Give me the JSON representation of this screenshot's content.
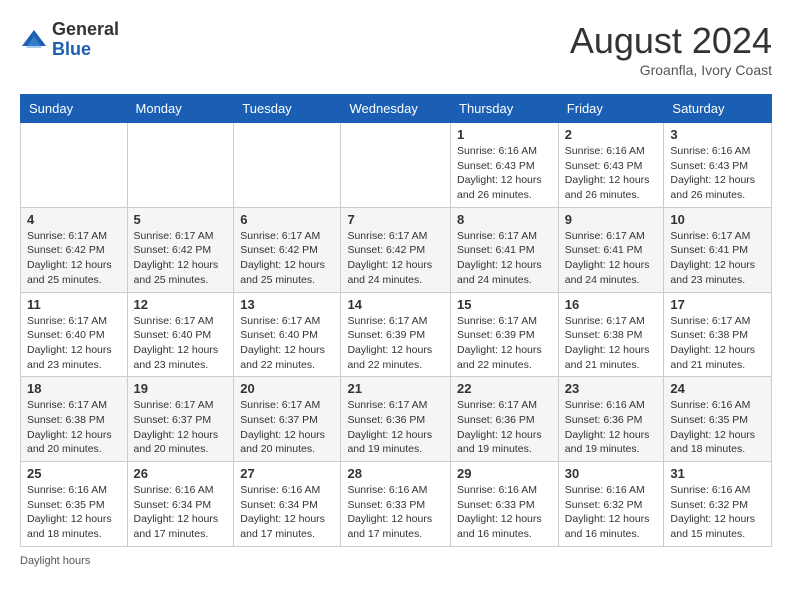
{
  "header": {
    "logo_general": "General",
    "logo_blue": "Blue",
    "month_year": "August 2024",
    "location": "Groanfla, Ivory Coast"
  },
  "days_of_week": [
    "Sunday",
    "Monday",
    "Tuesday",
    "Wednesday",
    "Thursday",
    "Friday",
    "Saturday"
  ],
  "weeks": [
    [
      {
        "day": "",
        "info": ""
      },
      {
        "day": "",
        "info": ""
      },
      {
        "day": "",
        "info": ""
      },
      {
        "day": "",
        "info": ""
      },
      {
        "day": "1",
        "info": "Sunrise: 6:16 AM\nSunset: 6:43 PM\nDaylight: 12 hours\nand 26 minutes."
      },
      {
        "day": "2",
        "info": "Sunrise: 6:16 AM\nSunset: 6:43 PM\nDaylight: 12 hours\nand 26 minutes."
      },
      {
        "day": "3",
        "info": "Sunrise: 6:16 AM\nSunset: 6:43 PM\nDaylight: 12 hours\nand 26 minutes."
      }
    ],
    [
      {
        "day": "4",
        "info": "Sunrise: 6:17 AM\nSunset: 6:42 PM\nDaylight: 12 hours\nand 25 minutes."
      },
      {
        "day": "5",
        "info": "Sunrise: 6:17 AM\nSunset: 6:42 PM\nDaylight: 12 hours\nand 25 minutes."
      },
      {
        "day": "6",
        "info": "Sunrise: 6:17 AM\nSunset: 6:42 PM\nDaylight: 12 hours\nand 25 minutes."
      },
      {
        "day": "7",
        "info": "Sunrise: 6:17 AM\nSunset: 6:42 PM\nDaylight: 12 hours\nand 24 minutes."
      },
      {
        "day": "8",
        "info": "Sunrise: 6:17 AM\nSunset: 6:41 PM\nDaylight: 12 hours\nand 24 minutes."
      },
      {
        "day": "9",
        "info": "Sunrise: 6:17 AM\nSunset: 6:41 PM\nDaylight: 12 hours\nand 24 minutes."
      },
      {
        "day": "10",
        "info": "Sunrise: 6:17 AM\nSunset: 6:41 PM\nDaylight: 12 hours\nand 23 minutes."
      }
    ],
    [
      {
        "day": "11",
        "info": "Sunrise: 6:17 AM\nSunset: 6:40 PM\nDaylight: 12 hours\nand 23 minutes."
      },
      {
        "day": "12",
        "info": "Sunrise: 6:17 AM\nSunset: 6:40 PM\nDaylight: 12 hours\nand 23 minutes."
      },
      {
        "day": "13",
        "info": "Sunrise: 6:17 AM\nSunset: 6:40 PM\nDaylight: 12 hours\nand 22 minutes."
      },
      {
        "day": "14",
        "info": "Sunrise: 6:17 AM\nSunset: 6:39 PM\nDaylight: 12 hours\nand 22 minutes."
      },
      {
        "day": "15",
        "info": "Sunrise: 6:17 AM\nSunset: 6:39 PM\nDaylight: 12 hours\nand 22 minutes."
      },
      {
        "day": "16",
        "info": "Sunrise: 6:17 AM\nSunset: 6:38 PM\nDaylight: 12 hours\nand 21 minutes."
      },
      {
        "day": "17",
        "info": "Sunrise: 6:17 AM\nSunset: 6:38 PM\nDaylight: 12 hours\nand 21 minutes."
      }
    ],
    [
      {
        "day": "18",
        "info": "Sunrise: 6:17 AM\nSunset: 6:38 PM\nDaylight: 12 hours\nand 20 minutes."
      },
      {
        "day": "19",
        "info": "Sunrise: 6:17 AM\nSunset: 6:37 PM\nDaylight: 12 hours\nand 20 minutes."
      },
      {
        "day": "20",
        "info": "Sunrise: 6:17 AM\nSunset: 6:37 PM\nDaylight: 12 hours\nand 20 minutes."
      },
      {
        "day": "21",
        "info": "Sunrise: 6:17 AM\nSunset: 6:36 PM\nDaylight: 12 hours\nand 19 minutes."
      },
      {
        "day": "22",
        "info": "Sunrise: 6:17 AM\nSunset: 6:36 PM\nDaylight: 12 hours\nand 19 minutes."
      },
      {
        "day": "23",
        "info": "Sunrise: 6:16 AM\nSunset: 6:36 PM\nDaylight: 12 hours\nand 19 minutes."
      },
      {
        "day": "24",
        "info": "Sunrise: 6:16 AM\nSunset: 6:35 PM\nDaylight: 12 hours\nand 18 minutes."
      }
    ],
    [
      {
        "day": "25",
        "info": "Sunrise: 6:16 AM\nSunset: 6:35 PM\nDaylight: 12 hours\nand 18 minutes."
      },
      {
        "day": "26",
        "info": "Sunrise: 6:16 AM\nSunset: 6:34 PM\nDaylight: 12 hours\nand 17 minutes."
      },
      {
        "day": "27",
        "info": "Sunrise: 6:16 AM\nSunset: 6:34 PM\nDaylight: 12 hours\nand 17 minutes."
      },
      {
        "day": "28",
        "info": "Sunrise: 6:16 AM\nSunset: 6:33 PM\nDaylight: 12 hours\nand 17 minutes."
      },
      {
        "day": "29",
        "info": "Sunrise: 6:16 AM\nSunset: 6:33 PM\nDaylight: 12 hours\nand 16 minutes."
      },
      {
        "day": "30",
        "info": "Sunrise: 6:16 AM\nSunset: 6:32 PM\nDaylight: 12 hours\nand 16 minutes."
      },
      {
        "day": "31",
        "info": "Sunrise: 6:16 AM\nSunset: 6:32 PM\nDaylight: 12 hours\nand 15 minutes."
      }
    ]
  ],
  "footer": {
    "daylight_label": "Daylight hours"
  }
}
